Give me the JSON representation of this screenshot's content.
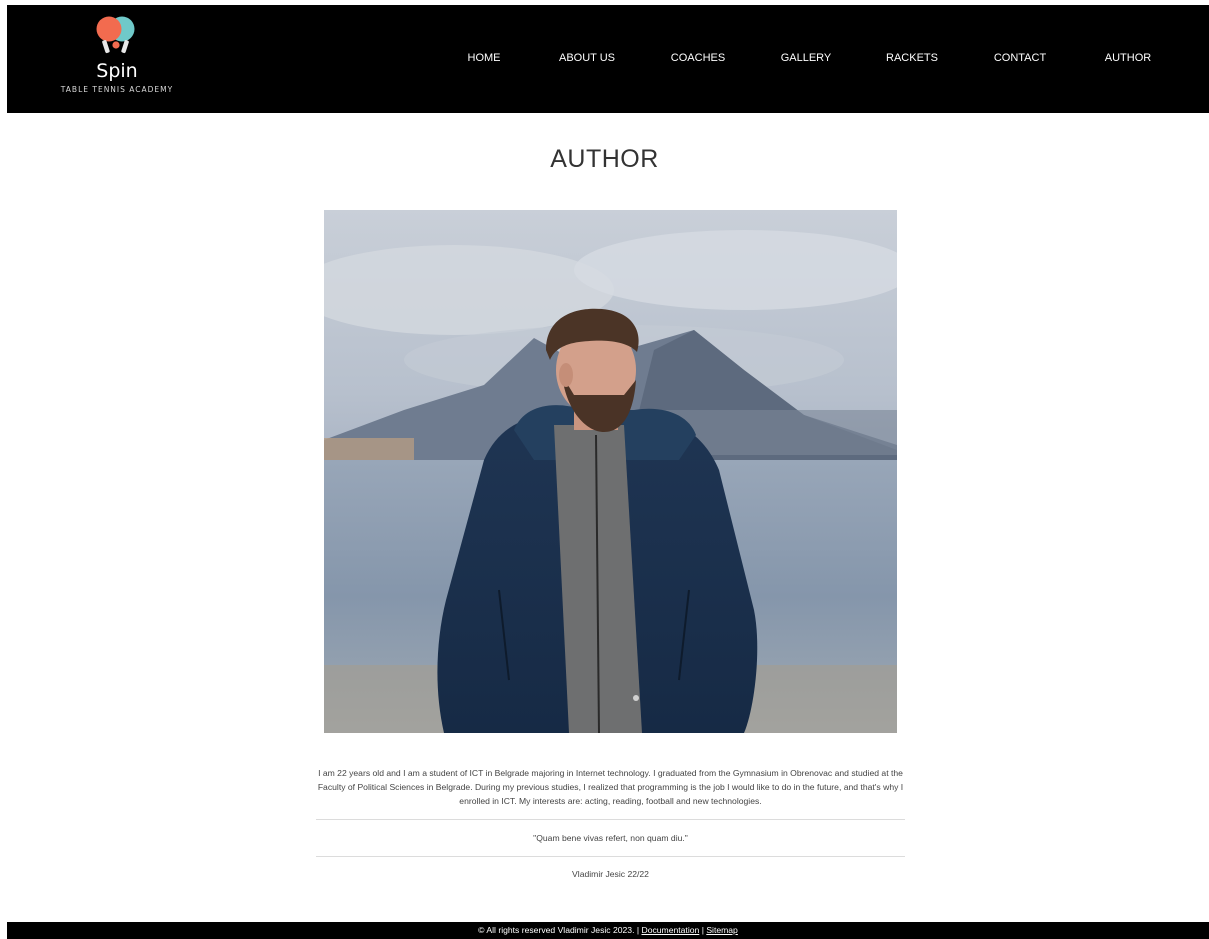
{
  "brand": {
    "name": "Spin",
    "tagline": "TABLE TENNIS ACADEMY",
    "logo_icon": "ping-pong-paddles-icon",
    "paddle_colors": [
      "#f26b4f",
      "#6fc9c9"
    ]
  },
  "nav": {
    "items": [
      {
        "label": "HOME"
      },
      {
        "label": "ABOUT US"
      },
      {
        "label": "COACHES"
      },
      {
        "label": "GALLERY"
      },
      {
        "label": "RACKETS"
      },
      {
        "label": "CONTACT"
      },
      {
        "label": "AUTHOR"
      }
    ]
  },
  "main": {
    "title": "AUTHOR",
    "bio": "I am 22 years old and I am a student of ICT in Belgrade majoring in Internet technology. I graduated from the Gymnasium in Obrenovac and studied at the Faculty of Political Sciences in Belgrade. During my previous studies, I realized that programming is the job I would like to do in the future, and that's why I enrolled in ICT. My interests are: acting, reading, football and new technologies.",
    "quote": "\"Quam bene vivas refert, non quam diu.\"",
    "signature": "Vladimir Jesic 22/22"
  },
  "footer": {
    "copyright": "© All rights reserved Vladimir Jesic 2023. |",
    "documentation_label": "Documentation",
    "separator": "|",
    "sitemap_label": "Sitemap"
  },
  "colors": {
    "header_bg": "#000000",
    "footer_bg": "#000000",
    "text": "#444444",
    "title": "#333333"
  }
}
